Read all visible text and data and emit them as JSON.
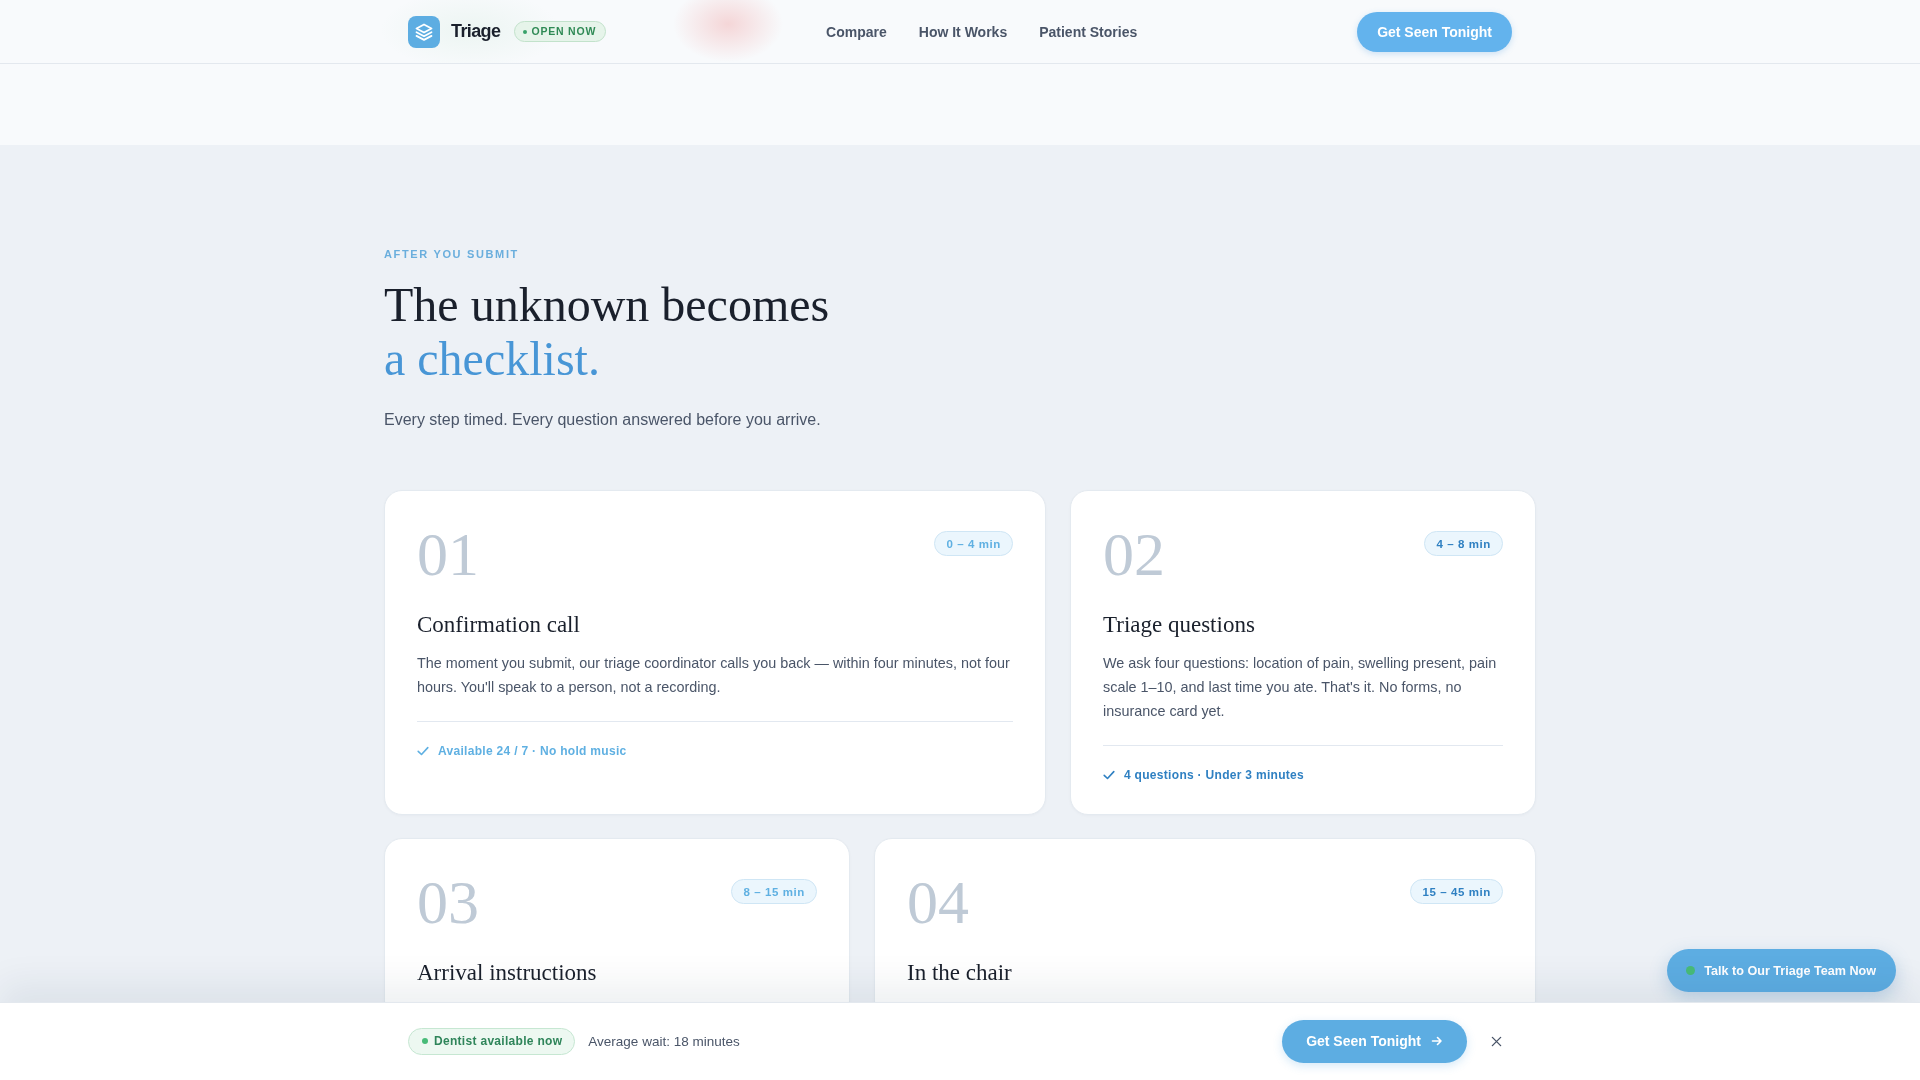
{
  "header": {
    "brand": "Triage",
    "status_badge": "OPEN NOW",
    "nav": [
      "Compare",
      "How It Works",
      "Patient Stories"
    ],
    "cta": "Get Seen Tonight"
  },
  "section": {
    "eyebrow": "AFTER YOU SUBMIT",
    "heading": "The unknown becomes",
    "heading_accent": "a checklist.",
    "subtitle": "Every step timed. Every question answered before you arrive."
  },
  "steps": [
    {
      "number": "01",
      "duration": "0 – 4 min",
      "color": "#5fb0e2",
      "title": "Confirmation call",
      "description": "The moment you submit, our triage coordinator calls you back — within four minutes, not four hours. You'll speak to a person, not a recording.",
      "note": "Available 24 / 7 · No hold music"
    },
    {
      "number": "02",
      "duration": "4 – 8 min",
      "color": "#2f80c2",
      "title": "Triage questions",
      "description": "We ask four questions: location of pain, swelling present, pain scale 1–10, and last time you ate. That's it. No forms, no insurance card yet.",
      "note": "4 questions · Under 3 minutes"
    },
    {
      "number": "03",
      "duration": "8 – 15 min",
      "color": "#5fb0e2",
      "title": "Arrival instructions"
    },
    {
      "number": "04",
      "duration": "15 – 45 min",
      "color": "#2f80c2",
      "title": "In the chair"
    }
  ],
  "chat_button": "Talk to Our Triage Team Now",
  "bottom_bar": {
    "status": "Dentist available now",
    "wait": "Average wait: 18 minutes",
    "cta": "Get Seen Tonight"
  }
}
